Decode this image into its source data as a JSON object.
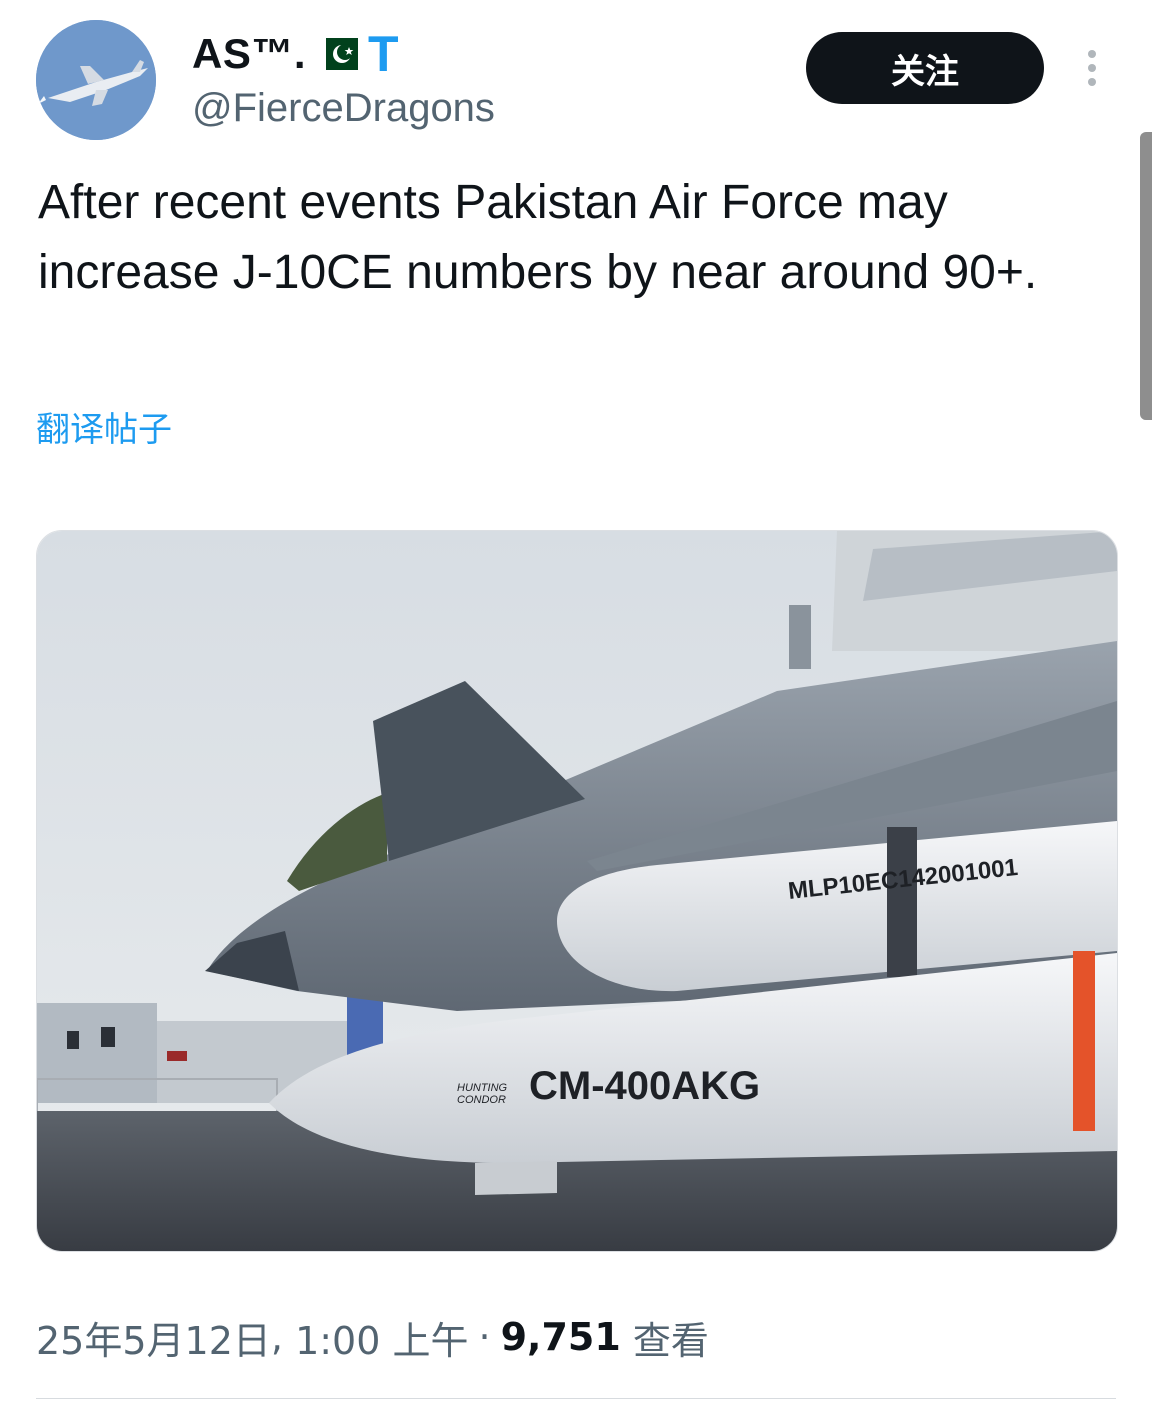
{
  "author": {
    "display_name": "AS™.",
    "verified_badge": "T",
    "handle": "@FierceDragons",
    "flag": "pakistan-flag"
  },
  "header": {
    "follow_label": "关注"
  },
  "tweet": {
    "text": "After recent events Pakistan Air Force may increase J-10CE numbers by near around 90+.",
    "translate_label": "翻译帖子"
  },
  "media": {
    "missile_marking": "CM-400AKG",
    "brand_marking_line1": "HUNTING",
    "brand_marking_line2": "CONDOR",
    "pod_marking": "MLP10EC142001001"
  },
  "meta": {
    "date": "25年5月12日",
    "time": "1:00 上午",
    "separator": "·",
    "views_count": "9,751",
    "views_label": "查看"
  },
  "colors": {
    "link": "#1d9bf0",
    "badge": "#1d9bf0",
    "button_bg": "#0f1419",
    "secondary_text": "#536471"
  }
}
